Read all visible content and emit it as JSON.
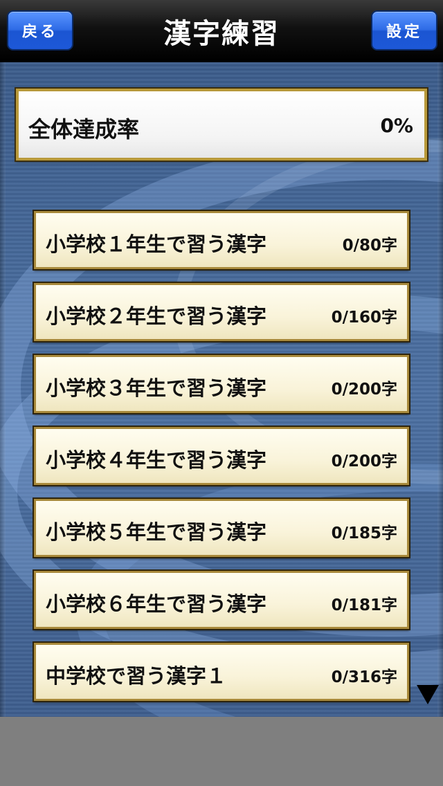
{
  "navbar": {
    "title": "漢字練習",
    "back_label": "戻る",
    "settings_label": "設定"
  },
  "overall": {
    "label": "全体達成率",
    "value": "0%"
  },
  "grades": [
    {
      "label": "小学校１年生で習う漢字",
      "count": "0/80字"
    },
    {
      "label": "小学校２年生で習う漢字",
      "count": "0/160字"
    },
    {
      "label": "小学校３年生で習う漢字",
      "count": "0/200字"
    },
    {
      "label": "小学校４年生で習う漢字",
      "count": "0/200字"
    },
    {
      "label": "小学校５年生で習う漢字",
      "count": "0/185字"
    },
    {
      "label": "小学校６年生で習う漢字",
      "count": "0/181字"
    },
    {
      "label": "中学校で習う漢字１",
      "count": "0/316字"
    }
  ],
  "colors": {
    "accent_button": "#2e6be6",
    "panel_border": "#b99a3b",
    "background": "#4d71a3"
  },
  "icons": {
    "scroll_indicator": "triangle-down-icon"
  }
}
